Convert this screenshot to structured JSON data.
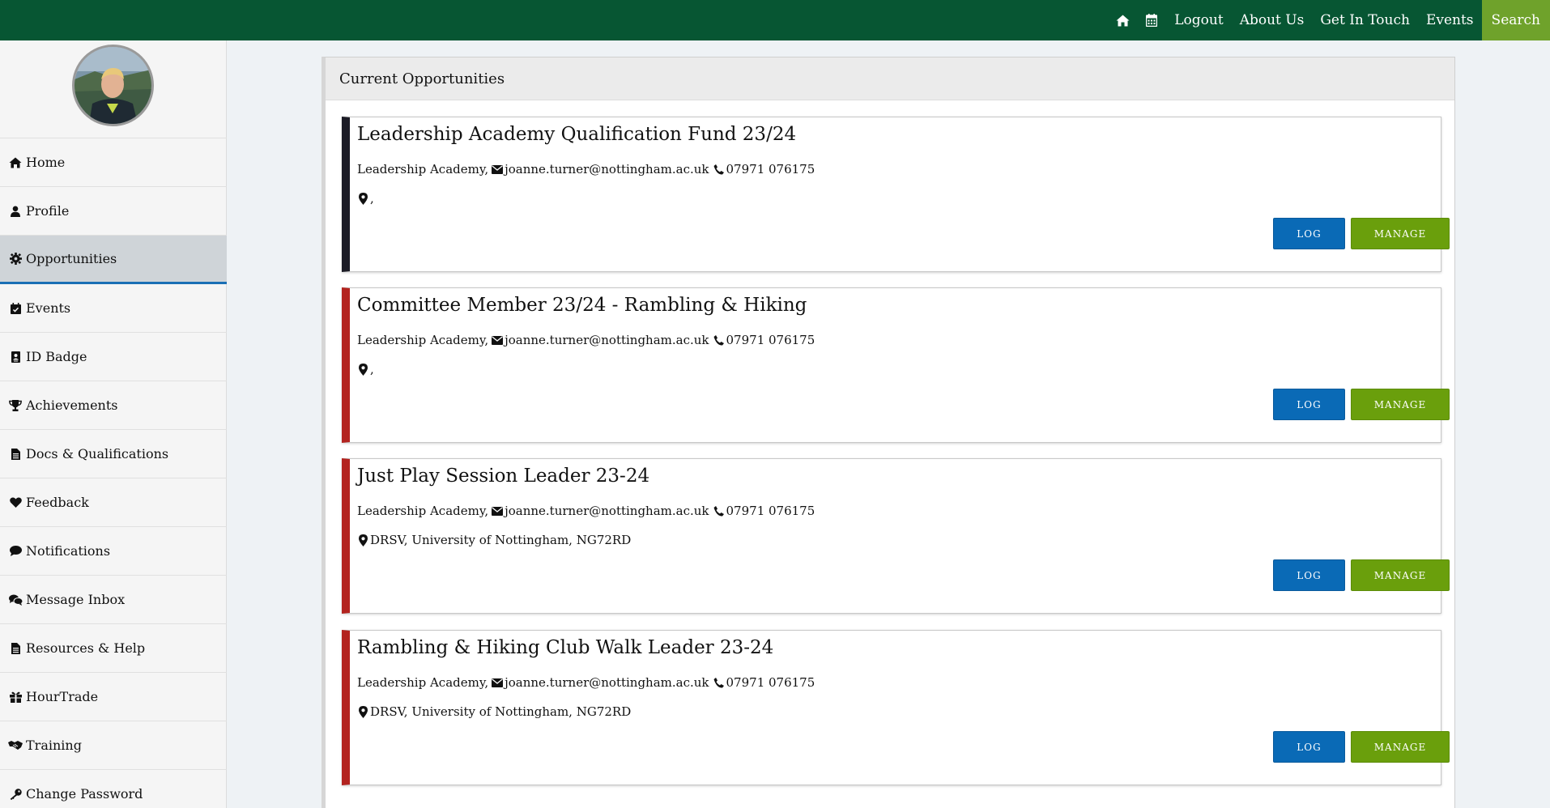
{
  "topnav": {
    "home_icon": "home-icon",
    "calendar_icon": "calendar-icon",
    "logout": "Logout",
    "about": "About Us",
    "contact": "Get In Touch",
    "events": "Events",
    "search": "Search"
  },
  "colors": {
    "topbar": "#075633",
    "search_bg": "#6fa22b",
    "log_button": "#0a6ab6",
    "manage_button": "#6a9f0c",
    "card_accent_red": "#b3231f",
    "card_accent_dark": "#1c1c26",
    "active_underline": "#1a6fb5"
  },
  "sidebar": {
    "avatar": "profile-photo",
    "items": [
      {
        "label": "Home",
        "icon": "home-icon"
      },
      {
        "label": "Profile",
        "icon": "user-icon"
      },
      {
        "label": "Opportunities",
        "icon": "cog-icon",
        "active": true
      },
      {
        "label": "Events",
        "icon": "calendar-check-icon"
      },
      {
        "label": "ID Badge",
        "icon": "id-badge-icon"
      },
      {
        "label": "Achievements",
        "icon": "trophy-icon"
      },
      {
        "label": "Docs & Qualifications",
        "icon": "document-icon"
      },
      {
        "label": "Feedback",
        "icon": "heart-icon"
      },
      {
        "label": "Notifications",
        "icon": "comment-icon"
      },
      {
        "label": "Message Inbox",
        "icon": "comments-icon"
      },
      {
        "label": "Resources & Help",
        "icon": "file-icon"
      },
      {
        "label": "HourTrade",
        "icon": "gift-icon"
      },
      {
        "label": "Training",
        "icon": "handshake-icon"
      },
      {
        "label": "Change Password",
        "icon": "key-icon"
      }
    ]
  },
  "main": {
    "title": "Current Opportunities",
    "cards": [
      {
        "title": "Leadership Academy Qualification Fund 23/24",
        "org": "Leadership Academy,",
        "email": "joanne.turner@nottingham.ac.uk",
        "phone": "07971 076175",
        "location": ",",
        "accent": "dark",
        "log_label": "LOG",
        "manage_label": "MANAGE"
      },
      {
        "title": "Committee Member 23/24 - Rambling & Hiking",
        "org": "Leadership Academy,",
        "email": "joanne.turner@nottingham.ac.uk",
        "phone": "07971 076175",
        "location": ",",
        "accent": "red",
        "log_label": "LOG",
        "manage_label": "MANAGE"
      },
      {
        "title": "Just Play Session Leader 23-24",
        "org": "Leadership Academy,",
        "email": "joanne.turner@nottingham.ac.uk",
        "phone": "07971 076175",
        "location": "DRSV, University of Nottingham, NG72RD",
        "accent": "red",
        "log_label": "LOG",
        "manage_label": "MANAGE"
      },
      {
        "title": "Rambling & Hiking Club Walk Leader 23-24",
        "org": "Leadership Academy,",
        "email": "joanne.turner@nottingham.ac.uk",
        "phone": "07971 076175",
        "location": "DRSV, University of Nottingham, NG72RD",
        "accent": "red",
        "log_label": "LOG",
        "manage_label": "MANAGE"
      }
    ]
  }
}
